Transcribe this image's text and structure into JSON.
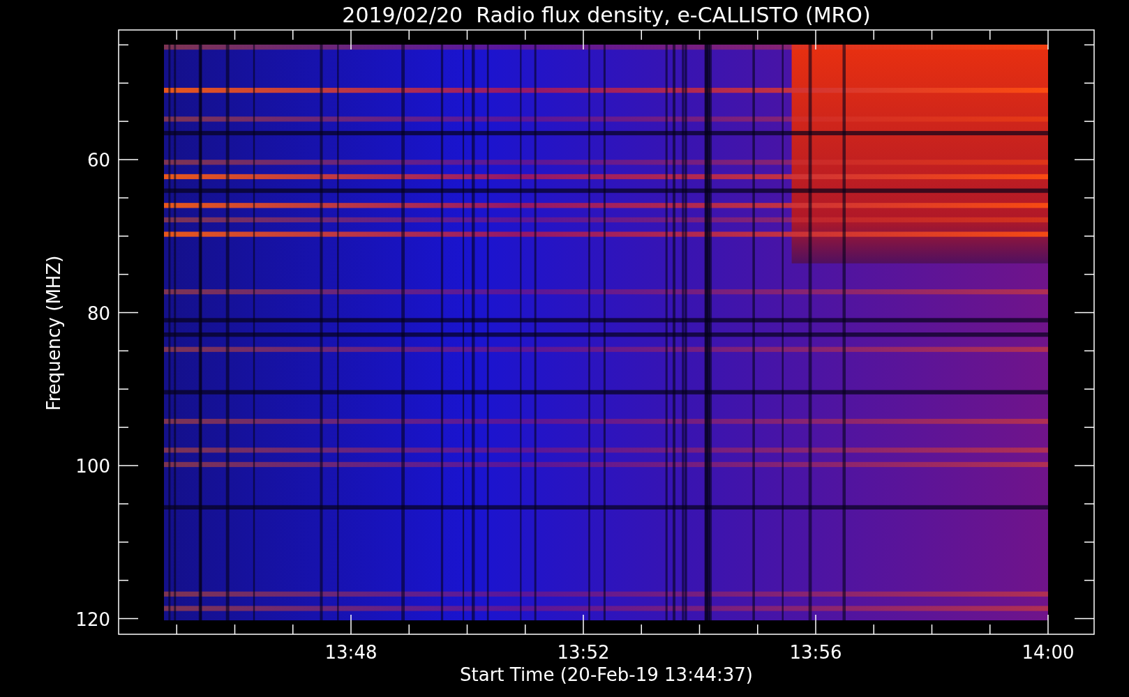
{
  "title": "2019/02/20  Radio flux density, e-CALLISTO (MRO)",
  "y_axis": {
    "label": "Frequency (MHZ)",
    "ticks": [
      "60",
      "80",
      "100",
      "120"
    ]
  },
  "x_axis": {
    "label": "Start Time (20-Feb-19 13:44:37)",
    "ticks": [
      "13:48",
      "13:52",
      "13:56",
      "14:00"
    ]
  }
}
